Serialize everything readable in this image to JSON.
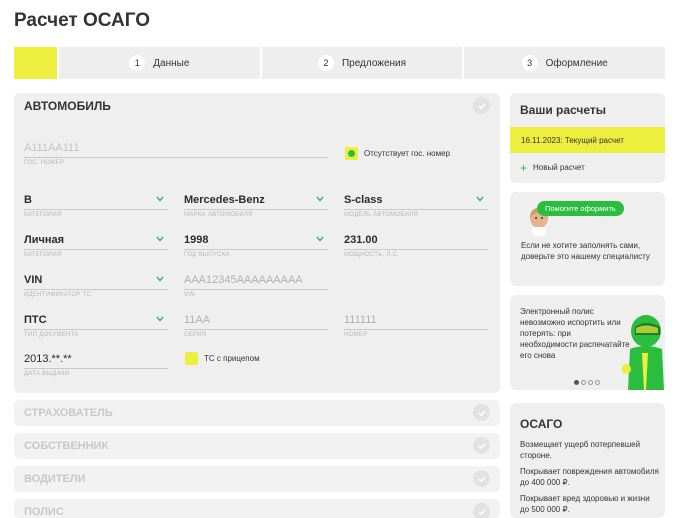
{
  "page": {
    "title": "Расчет ОСАГО"
  },
  "stepper": {
    "steps": [
      {
        "num": "1",
        "label": "Данные"
      },
      {
        "num": "2",
        "label": "Предложения"
      },
      {
        "num": "3",
        "label": "Оформление"
      }
    ]
  },
  "car": {
    "title": "АВТОМОБИЛЬ",
    "plate": {
      "placeholder": "А111АА111",
      "label": "ГОС. НОМЕР"
    },
    "no_plate": {
      "label": "Отсутствует гос. номер",
      "checked": true
    },
    "category": {
      "value": "B",
      "label": "КАТЕГОРИЯ"
    },
    "brand": {
      "value": "Mercedes-Benz",
      "label": "МАРКА АВТОМОБИЛЯ"
    },
    "model": {
      "value": "S-class",
      "label": "МОДЕЛЬ АВТОМОБИЛЯ"
    },
    "usage": {
      "value": "Личная",
      "label": "КАТЕГОРИЯ"
    },
    "year": {
      "value": "1998",
      "label": "ГОД ВЫПУСКА"
    },
    "power": {
      "value": "231.00",
      "label": "МОЩНОСТЬ, Л.С."
    },
    "id_type": {
      "value": "VIN",
      "label": "ИДЕНТИФИКАТОР ТС"
    },
    "vin": {
      "placeholder": "AAA12345AAAAAAAAA",
      "label": "VIN"
    },
    "doc_type": {
      "value": "ПТС",
      "label": "ТИП ДОКУМЕНТА"
    },
    "series": {
      "placeholder": "11АА",
      "label": "СЕРИЯ"
    },
    "number": {
      "placeholder": "111111",
      "label": "НОМЕР"
    },
    "issue_date": {
      "value": "2013.**.**",
      "label": "ДАТА ВЫДАЧИ"
    },
    "trailer": {
      "label": "ТС с прицепом",
      "checked": false
    }
  },
  "sections": [
    {
      "title": "СТРАХОВАТЕЛЬ"
    },
    {
      "title": "СОБСТВЕННИК"
    },
    {
      "title": "ВОДИТЕЛИ"
    },
    {
      "title": "ПОЛИС"
    }
  ],
  "sidebar": {
    "calculations": {
      "title": "Ваши расчеты",
      "current": "16.11.2023: Текущий расчет",
      "new": "Новый расчет"
    },
    "help": {
      "button": "Помогите оформить",
      "text": "Если не хотите заполнять сами, доверьте это нашему специалисту"
    },
    "promo": {
      "text": "Электронный полис невозможно испортить или потерять: при необходимости распечатайте его снова",
      "active_slide": 1
    },
    "osago": {
      "title": "ОСАГО",
      "items": [
        "Возмещает ущерб потерпевшей стороне.",
        "Покрывает повреждения автомобиля до 400 000 ₽.",
        "Покрывает вред здоровью и жизни до 500 000 ₽."
      ]
    }
  },
  "colors": {
    "accent_yellow": "#eeee3e",
    "accent_green": "#2bbd3e",
    "panel_bg": "#efefef"
  }
}
